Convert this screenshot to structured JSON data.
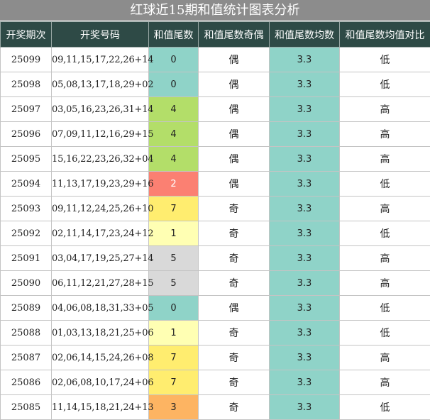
{
  "title": "红球近15期和值统计图表分析",
  "headers": [
    "开奖期次",
    "开奖号码",
    "和值尾数",
    "和值尾数奇偶",
    "和值尾数均数",
    "和值尾数均值对比"
  ],
  "tail_colors": {
    "0": "#8fd3c8",
    "1": "#ffffb3",
    "2": "#fb8072",
    "3": "#fdb462",
    "4": "#b3de69",
    "5": "#d9d9d9",
    "7": "#ffed6f"
  },
  "rows": [
    {
      "issue": "25099",
      "numbers": "09,11,15,17,22,26+14",
      "tail": "0",
      "parity": "偶",
      "avg": "3.3",
      "cmp": "低"
    },
    {
      "issue": "25098",
      "numbers": "05,08,13,17,18,29+02",
      "tail": "0",
      "parity": "偶",
      "avg": "3.3",
      "cmp": "低"
    },
    {
      "issue": "25097",
      "numbers": "03,05,16,23,26,31+14",
      "tail": "4",
      "parity": "偶",
      "avg": "3.3",
      "cmp": "高"
    },
    {
      "issue": "25096",
      "numbers": "07,09,11,12,16,29+15",
      "tail": "4",
      "parity": "偶",
      "avg": "3.3",
      "cmp": "高"
    },
    {
      "issue": "25095",
      "numbers": "15,16,22,23,26,32+04",
      "tail": "4",
      "parity": "偶",
      "avg": "3.3",
      "cmp": "高"
    },
    {
      "issue": "25094",
      "numbers": "11,13,17,19,23,29+16",
      "tail": "2",
      "parity": "偶",
      "avg": "3.3",
      "cmp": "低"
    },
    {
      "issue": "25093",
      "numbers": "09,11,12,24,25,26+10",
      "tail": "7",
      "parity": "奇",
      "avg": "3.3",
      "cmp": "高"
    },
    {
      "issue": "25092",
      "numbers": "02,11,14,17,23,24+12",
      "tail": "1",
      "parity": "奇",
      "avg": "3.3",
      "cmp": "低"
    },
    {
      "issue": "25091",
      "numbers": "03,04,17,19,25,27+14",
      "tail": "5",
      "parity": "奇",
      "avg": "3.3",
      "cmp": "高"
    },
    {
      "issue": "25090",
      "numbers": "06,11,12,21,27,28+15",
      "tail": "5",
      "parity": "奇",
      "avg": "3.3",
      "cmp": "高"
    },
    {
      "issue": "25089",
      "numbers": "04,06,08,18,31,33+05",
      "tail": "0",
      "parity": "偶",
      "avg": "3.3",
      "cmp": "低"
    },
    {
      "issue": "25088",
      "numbers": "01,03,13,18,21,25+06",
      "tail": "1",
      "parity": "奇",
      "avg": "3.3",
      "cmp": "低"
    },
    {
      "issue": "25087",
      "numbers": "02,06,14,15,24,26+08",
      "tail": "7",
      "parity": "奇",
      "avg": "3.3",
      "cmp": "高"
    },
    {
      "issue": "25086",
      "numbers": "02,06,08,10,17,24+06",
      "tail": "7",
      "parity": "奇",
      "avg": "3.3",
      "cmp": "高"
    },
    {
      "issue": "25085",
      "numbers": "11,14,15,18,21,24+13",
      "tail": "3",
      "parity": "奇",
      "avg": "3.3",
      "cmp": "低"
    }
  ]
}
